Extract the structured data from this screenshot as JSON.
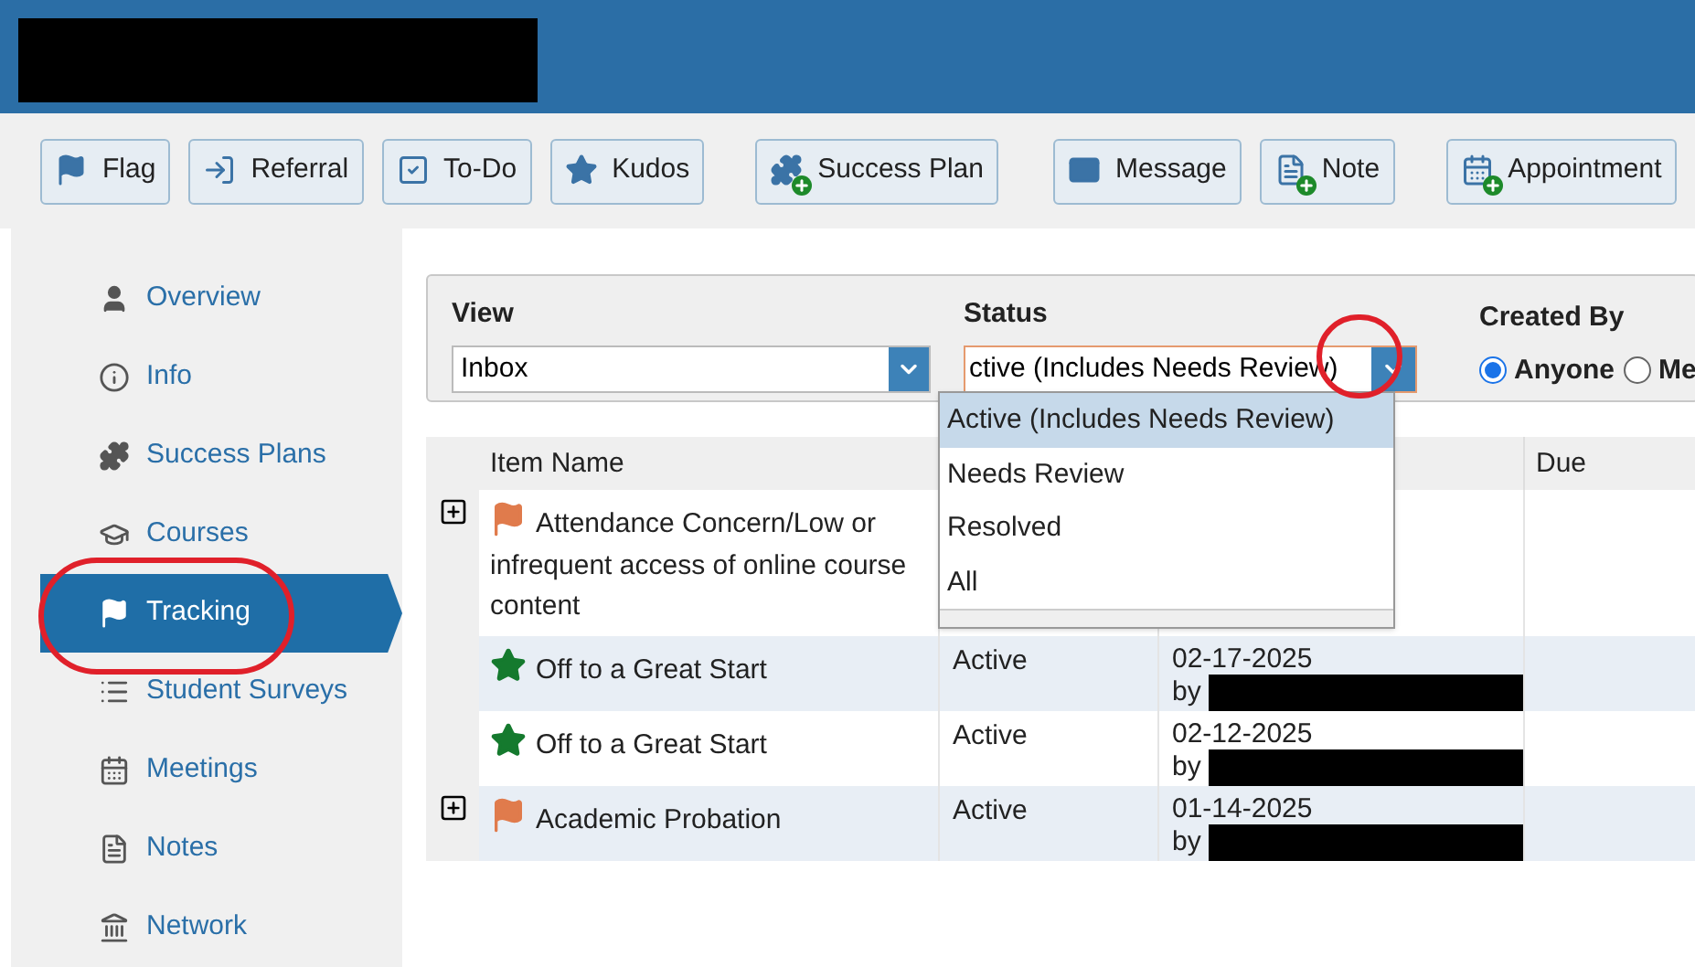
{
  "toolbar": [
    {
      "label": "Flag"
    },
    {
      "label": "Referral"
    },
    {
      "label": "To-Do"
    },
    {
      "label": "Kudos"
    },
    {
      "label": "Success Plan"
    },
    {
      "label": "Message"
    },
    {
      "label": "Note"
    },
    {
      "label": "Appointment"
    }
  ],
  "sidebar": {
    "items": [
      {
        "label": "Overview",
        "selected": false
      },
      {
        "label": "Info",
        "selected": false
      },
      {
        "label": "Success Plans",
        "selected": false
      },
      {
        "label": "Courses",
        "selected": false
      },
      {
        "label": "Tracking",
        "selected": true
      },
      {
        "label": "Student Surveys",
        "selected": false
      },
      {
        "label": "Meetings",
        "selected": false
      },
      {
        "label": "Notes",
        "selected": false
      },
      {
        "label": "Network",
        "selected": false
      }
    ]
  },
  "filters": {
    "view": {
      "label": "View",
      "value": "Inbox"
    },
    "status": {
      "label": "Status",
      "value": "ctive (Includes Needs Review)",
      "expanded": true,
      "options": [
        {
          "label": "Active (Includes Needs Review)",
          "selected": true
        },
        {
          "label": "Needs Review",
          "selected": false
        },
        {
          "label": "Resolved",
          "selected": false
        },
        {
          "label": "All",
          "selected": false
        }
      ]
    },
    "created_by": {
      "label": "Created By",
      "options": [
        {
          "label": "Anyone",
          "selected": true
        },
        {
          "label": "Me",
          "selected": false
        }
      ]
    }
  },
  "table": {
    "columns": [
      "Item Name",
      "Due"
    ],
    "rows": [
      {
        "kind": "flag",
        "expandable": true,
        "name": "Attendance Concern/Low or infrequent access of online course content"
      },
      {
        "kind": "kudos",
        "expandable": false,
        "name": "Off to a Great Start",
        "status": "Active",
        "date": "02-17-2025",
        "by": "by"
      },
      {
        "kind": "kudos",
        "expandable": false,
        "name": "Off to a Great Start",
        "status": "Active",
        "date": "02-12-2025",
        "by": "by"
      },
      {
        "kind": "flag",
        "expandable": true,
        "name": "Academic Probation",
        "status": "Active",
        "date": "01-14-2025",
        "by": "by"
      }
    ]
  }
}
